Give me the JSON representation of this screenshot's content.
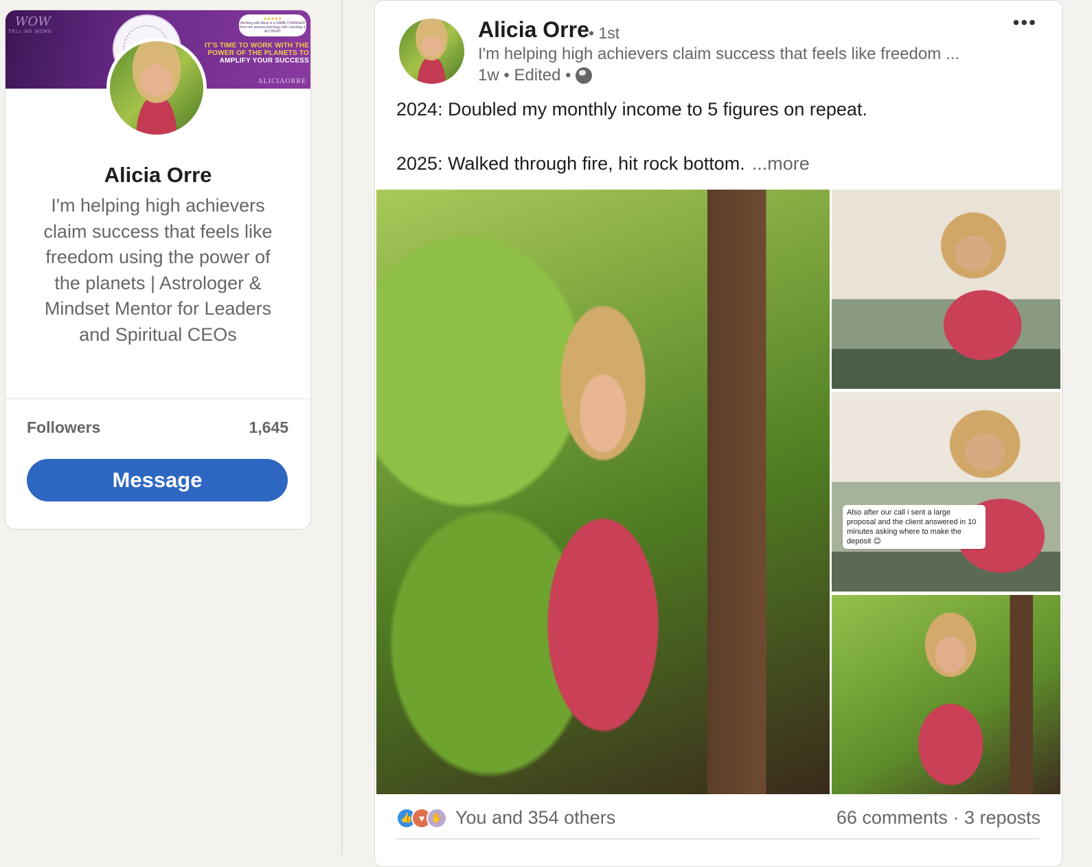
{
  "profile": {
    "name": "Alicia Orre",
    "headline": "I'm helping high achievers claim success that feels like freedom using the power of the planets | Astrologer & Mindset Mentor for Leaders and Spiritual CEOs",
    "followers_label": "Followers",
    "followers_count": "1,645",
    "message_label": "Message",
    "banner": {
      "script_text": "WOW",
      "sub_text": "TELL ME MORE",
      "bubble_stars": "★★★★★",
      "bubble_text": "Working with Alicia is a GAME CHANGER! How she weaves Astrology with coaching is ALCHEMY",
      "headline_1": "IT'S TIME TO WORK WITH THE",
      "headline_2": "POWER OF THE PLANETS TO",
      "headline_3": "AMPLIFY YOUR SUCCESS",
      "brand": "ALICIAORRE"
    }
  },
  "post": {
    "author_name": "Alicia Orre",
    "degree": "• 1st",
    "author_headline": "I'm helping high achievers claim success that feels like freedom ...",
    "time": "1w",
    "edited": "Edited",
    "visibility_icon": "globe-icon",
    "menu_icon": "ellipsis-icon",
    "line1": "2024: Doubled my monthly income to 5 figures on repeat.",
    "line2": "2025: Walked through fire, hit rock bottom.",
    "see_more": "...more",
    "chat_overlay": "Also after our call i sent a large proposal and the client answered in 10 minutes asking where to make the deposit 😊",
    "reactions_text": "You and 354 others",
    "comments": "66 comments",
    "reposts": "3 reposts"
  },
  "colors": {
    "accent": "#2e67c2",
    "page_bg": "#f4f2ee",
    "banner_purple": "#6b2b8a"
  }
}
